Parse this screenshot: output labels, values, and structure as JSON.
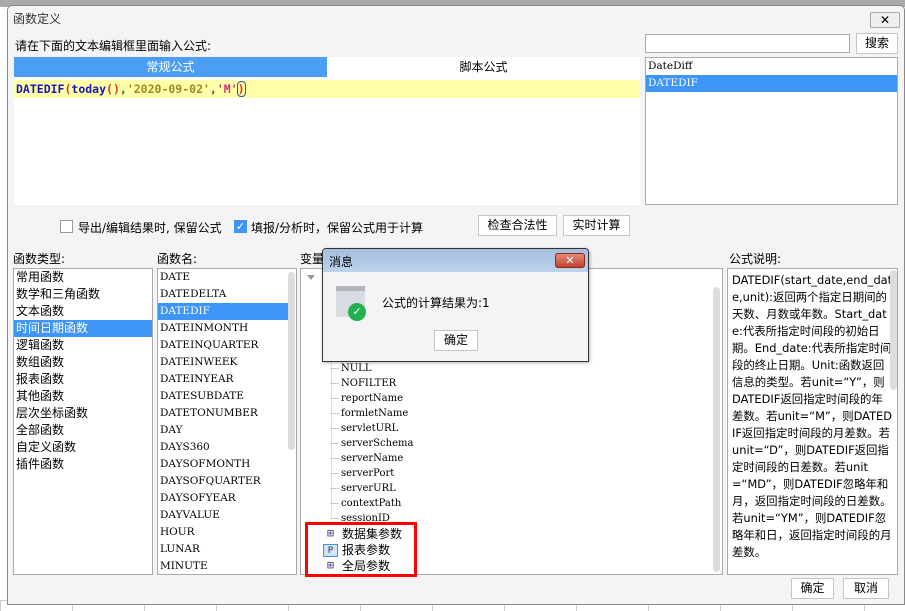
{
  "window": {
    "title": "函数定义",
    "close": "✕"
  },
  "editor": {
    "prompt": "请在下面的文本编辑框里面输入公式:",
    "tabs": [
      "常规公式",
      "脚本公式"
    ],
    "formula": {
      "fn": "DATEDIF",
      "p1": "(",
      "inner": "today",
      "p2": "()",
      ",1": ",",
      "date": "'2020-09-02'",
      "c2": ",",
      "unit": "'M'",
      "p3": ")"
    }
  },
  "search": {
    "value": "",
    "button": "搜索",
    "results": [
      "DateDiff",
      "DATEDIF"
    ]
  },
  "options": {
    "keep_formula_export": "导出/编辑结果时, 保留公式",
    "keep_formula_fill": "填报/分析时，保留公式用于计算",
    "check_button": "检查合法性",
    "realtime_button": "实时计算"
  },
  "function_types": {
    "label": "函数类型:",
    "items": [
      "常用函数",
      "数学和三角函数",
      "文本函数",
      "时间日期函数",
      "逻辑函数",
      "数组函数",
      "报表函数",
      "其他函数",
      "层次坐标函数",
      "全部函数",
      "自定义函数",
      "插件函数"
    ]
  },
  "function_names": {
    "label": "函数名:",
    "items": [
      "DATE",
      "DATEDELTA",
      "DATEDIF",
      "DATEINMONTH",
      "DATEINQUARTER",
      "DATEINWEEK",
      "DATEINYEAR",
      "DATESUBDATE",
      "DATETONUMBER",
      "DAY",
      "DAYS360",
      "DAYSOFMONTH",
      "DAYSOFQUARTER",
      "DAYSOFYEAR",
      "DAYVALUE",
      "HOUR",
      "LUNAR",
      "MINUTE"
    ]
  },
  "variables": {
    "label": "变量",
    "items": [
      "NULL",
      "NOFILTER",
      "reportName",
      "formletName",
      "servletURL",
      "serverSchema",
      "serverName",
      "serverPort",
      "serverURL",
      "contextPath",
      "sessionID"
    ],
    "groups": [
      "数据集参数",
      "报表参数",
      "全局参数"
    ]
  },
  "description": {
    "label": "公式说明:",
    "text": "DATEDIF(start_date,end_date,unit):返回两个指定日期间的天数、月数或年数。Start_date:代表所指定时间段的初始日期。End_date:代表所指定时间段的终止日期。Unit:函数返回信息的类型。若unit=“Y”，则DATEDIF返回指定时间段的年差数。若unit=“M”，则DATEDIF返回指定时间段的月差数。若unit=“D”，则DATEDIF返回指定时间段的日差数。若unit=“MD”，则DATEDIF忽略年和月，返回指定时间段的日差数。若unit=“YM”，则DATEDIF忽略年和日，返回指定时间段的月差数。"
  },
  "footer": {
    "ok": "确定",
    "cancel": "取消"
  },
  "message": {
    "title": "消息",
    "text": "公式的计算结果为:",
    "result": "1",
    "ok": "确定",
    "close": "✕"
  }
}
